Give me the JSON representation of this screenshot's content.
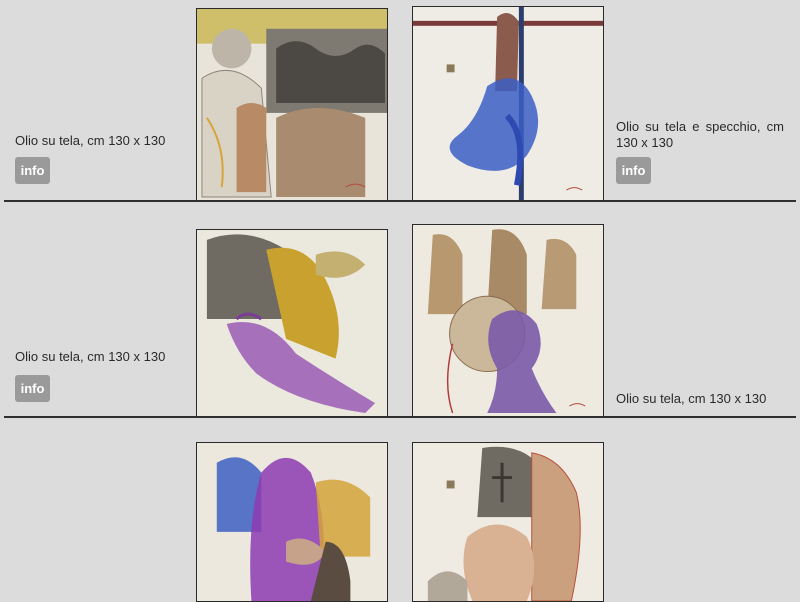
{
  "gallery": {
    "rows": [
      {
        "left_caption": "Olio su tela, cm 130 x 130",
        "left_button": "info",
        "right_caption": "Olio su tela e specchio, cm 130 x 130",
        "right_button": "info"
      },
      {
        "left_caption": "Olio su tela, cm 130 x 130",
        "left_button": "info",
        "right_caption": "Olio su tela, cm 130 x 130"
      },
      {}
    ]
  }
}
